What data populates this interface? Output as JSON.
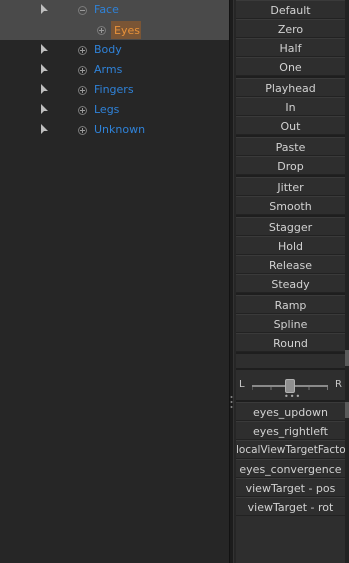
{
  "tree": {
    "items": [
      {
        "label": "Face",
        "selected": true
      },
      {
        "label": "Eyes",
        "highlighted": true
      },
      {
        "label": "Body"
      },
      {
        "label": "Arms"
      },
      {
        "label": "Fingers"
      },
      {
        "label": "Legs"
      },
      {
        "label": "Unknown"
      }
    ]
  },
  "panel": {
    "groups": [
      [
        "Default",
        "Zero",
        "Half",
        "One"
      ],
      [
        "Playhead",
        "In",
        "Out"
      ],
      [
        "Paste",
        "Drop"
      ],
      [
        "Jitter",
        "Smooth"
      ],
      [
        "Stagger",
        "Hold",
        "Release",
        "Steady"
      ],
      [
        "Ramp",
        "Spline",
        "Round"
      ]
    ],
    "slider": {
      "left_label": "L",
      "right_label": "R",
      "value": 0.5
    },
    "properties": [
      "eyes_updown",
      "eyes_rightleft",
      "localViewTargetFactor",
      "eyes_convergence",
      "viewTarget - pos",
      "viewTarget - rot"
    ]
  },
  "colors": {
    "tree_label": "#2f82d8",
    "selected_label": "#e8923a",
    "background": "#262626",
    "panel": "#2e2e2e"
  }
}
